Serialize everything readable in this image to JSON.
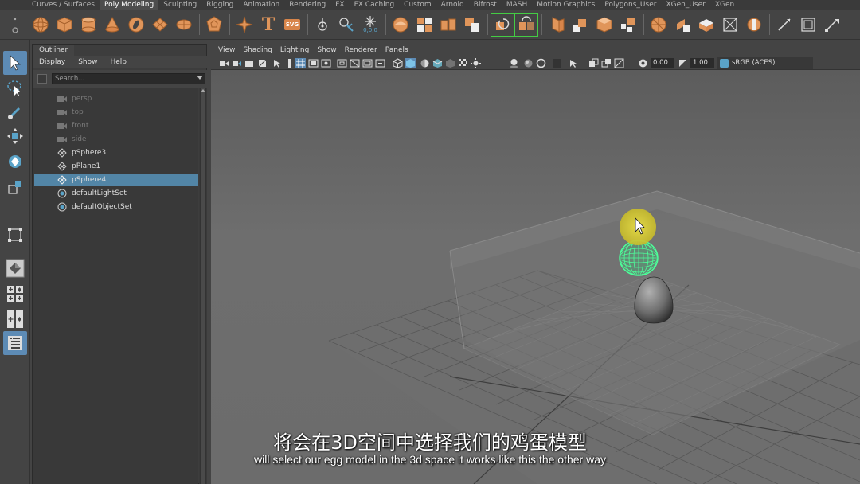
{
  "shelf_tabs": [
    "Curves / Surfaces",
    "Poly Modeling",
    "Sculpting",
    "Rigging",
    "Animation",
    "Rendering",
    "FX",
    "FX Caching",
    "Custom",
    "Arnold",
    "Bifrost",
    "MASH",
    "Motion Graphics",
    "Polygons_User",
    "XGen_User",
    "XGen"
  ],
  "active_shelf_tab": "Poly Modeling",
  "shelf_icons": [
    "poly-sphere-icon",
    "poly-cube-icon",
    "poly-cylinder-icon",
    "poly-cone-icon",
    "poly-torus-icon",
    "poly-plane-icon",
    "poly-disc-icon",
    "platonic-solid-icon",
    "super-shape-icon",
    "type-icon",
    "svg-icon",
    "sweep-mesh-icon",
    "sculpt-icon",
    "snowflake-icon",
    "combine-icon",
    "separate-icon",
    "extract-icon",
    "boolean-icon",
    "smooth-icon",
    "mirror-icon",
    "reduce-icon",
    "bridge-icon",
    "extrude-icon",
    "bevel-icon",
    "fill-hole-icon",
    "append-icon",
    "multi-cut-icon",
    "target-weld-icon",
    "quad-draw-icon",
    "wedge-icon",
    "poke-icon",
    "chamfer-icon",
    "edit-edge-flow-icon"
  ],
  "text_icons": {
    "type": "T",
    "svg": "SVG",
    "coords": "0,0,0"
  },
  "outliner": {
    "title": "Outliner",
    "menu": [
      "Display",
      "Show",
      "Help"
    ],
    "search_placeholder": "Search...",
    "items": [
      {
        "label": "persp",
        "icon": "camera-icon",
        "dim": true
      },
      {
        "label": "top",
        "icon": "camera-icon",
        "dim": true
      },
      {
        "label": "front",
        "icon": "camera-icon",
        "dim": true
      },
      {
        "label": "side",
        "icon": "camera-icon",
        "dim": true
      },
      {
        "label": "pSphere3",
        "icon": "mesh-icon",
        "dim": false
      },
      {
        "label": "pPlane1",
        "icon": "mesh-icon",
        "dim": false
      },
      {
        "label": "pSphere4",
        "icon": "mesh-icon",
        "dim": false,
        "selected": true
      },
      {
        "label": "defaultLightSet",
        "icon": "set-icon",
        "dim": false
      },
      {
        "label": "defaultObjectSet",
        "icon": "set-icon",
        "dim": false
      }
    ]
  },
  "viewport": {
    "menu": [
      "View",
      "Shading",
      "Lighting",
      "Show",
      "Renderer",
      "Panels"
    ],
    "exposure": "0.00",
    "gamma": "1.00",
    "color_space": "sRGB (ACES)"
  },
  "subtitles": {
    "cn": "将会在3D空间中选择我们的鸡蛋模型",
    "en": "will select our egg model in the 3d space it works like this the other way"
  },
  "colors": {
    "selected_row": "#5285a6",
    "selected_tool": "#5d8bb5",
    "wireframe_select": "#4dff9a",
    "cursor_highlight": "#d6cb3a"
  }
}
